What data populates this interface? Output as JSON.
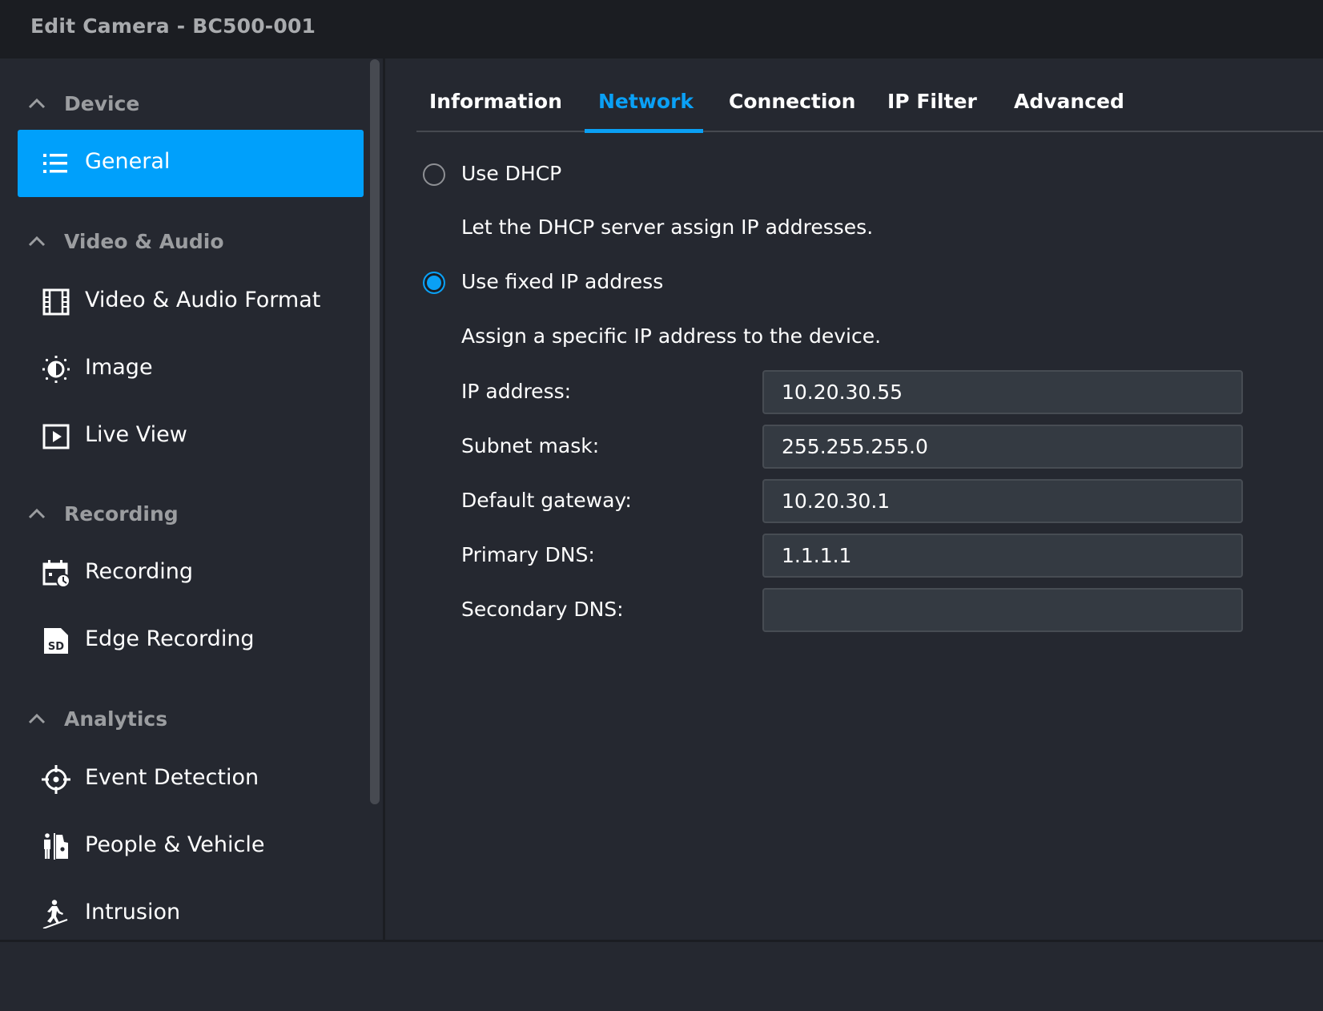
{
  "window": {
    "title": "Edit Camera - BC500-001"
  },
  "sidebar": {
    "sections": [
      {
        "label": "Device",
        "items": [
          {
            "label": "General",
            "icon": "list-icon",
            "active": true
          }
        ]
      },
      {
        "label": "Video & Audio",
        "items": [
          {
            "label": "Video & Audio Format",
            "icon": "film-icon",
            "active": false
          },
          {
            "label": "Image",
            "icon": "brightness-icon",
            "active": false
          },
          {
            "label": "Live View",
            "icon": "play-box-icon",
            "active": false
          }
        ]
      },
      {
        "label": "Recording",
        "items": [
          {
            "label": "Recording",
            "icon": "calendar-clock-icon",
            "active": false
          },
          {
            "label": "Edge Recording",
            "icon": "sd-card-icon",
            "active": false
          }
        ]
      },
      {
        "label": "Analytics",
        "items": [
          {
            "label": "Event Detection",
            "icon": "crosshair-icon",
            "active": false
          },
          {
            "label": "People & Vehicle",
            "icon": "person-vehicle-icon",
            "active": false
          },
          {
            "label": "Intrusion",
            "icon": "intrusion-icon",
            "active": false
          }
        ]
      }
    ]
  },
  "tabs": [
    {
      "label": "Information",
      "active": false
    },
    {
      "label": "Network",
      "active": true
    },
    {
      "label": "Connection",
      "active": false
    },
    {
      "label": "IP Filter",
      "active": false
    },
    {
      "label": "Advanced",
      "active": false
    }
  ],
  "network": {
    "options": [
      {
        "label": "Use DHCP",
        "description": "Let the DHCP server assign IP addresses.",
        "selected": false
      },
      {
        "label": "Use fixed IP address",
        "description": "Assign a specific IP address to the device.",
        "selected": true
      }
    ],
    "fields": [
      {
        "label": "IP address:",
        "value": "10.20.30.55"
      },
      {
        "label": "Subnet mask:",
        "value": "255.255.255.0"
      },
      {
        "label": "Default gateway:",
        "value": "10.20.30.1"
      },
      {
        "label": "Primary DNS:",
        "value": "1.1.1.1"
      },
      {
        "label": "Secondary DNS:",
        "value": ""
      }
    ]
  },
  "colors": {
    "accent": "#00a0fb",
    "tab_active": "#0aa0f5",
    "background": "#252830",
    "titlebar": "#1b1d22",
    "input_bg": "#343a42"
  }
}
